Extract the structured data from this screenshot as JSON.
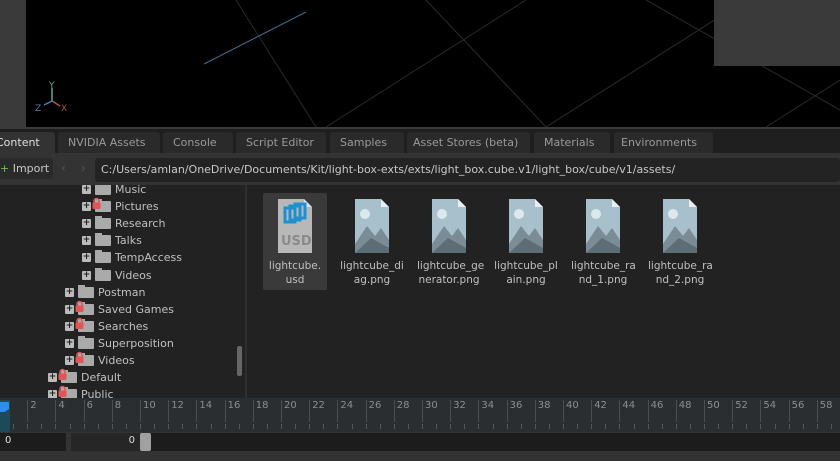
{
  "viewport": {
    "axis_labels": {
      "x": "X",
      "y": "Y",
      "z": "Z"
    }
  },
  "tabs": [
    {
      "label": "Content",
      "active": true
    },
    {
      "label": "NVIDIA Assets"
    },
    {
      "label": "Console"
    },
    {
      "label": "Script Editor"
    },
    {
      "label": "Samples"
    },
    {
      "label": "Asset Stores (beta)"
    },
    {
      "label": "Materials"
    },
    {
      "label": "Environments"
    }
  ],
  "toolbar": {
    "import_label": "Import",
    "import_icon": "+",
    "back_icon": "‹",
    "forward_icon": "›",
    "path": "C:/Users/amlan/OneDrive/Documents/Kit/light-box-exts/exts/light_box.cube.v1/light_box/cube/v1/assets/"
  },
  "tree": [
    {
      "label": "Music",
      "level": 2,
      "locked": false
    },
    {
      "label": "Pictures",
      "level": 2,
      "locked": true
    },
    {
      "label": "Research",
      "level": 2,
      "locked": false
    },
    {
      "label": "Talks",
      "level": 2,
      "locked": false
    },
    {
      "label": "TempAccess",
      "level": 2,
      "locked": false
    },
    {
      "label": "Videos",
      "level": 2,
      "locked": false
    },
    {
      "label": "Postman",
      "level": 1,
      "locked": false
    },
    {
      "label": "Saved Games",
      "level": 1,
      "locked": true
    },
    {
      "label": "Searches",
      "level": 1,
      "locked": true
    },
    {
      "label": "Superposition",
      "level": 1,
      "locked": false
    },
    {
      "label": "Videos",
      "level": 1,
      "locked": true
    },
    {
      "label": "Default",
      "level": 0,
      "locked": true
    },
    {
      "label": "Public",
      "level": 0,
      "locked": true
    }
  ],
  "files": [
    {
      "name": "lightcube.\nusd",
      "type": "usd",
      "selected": true,
      "badge": "USD"
    },
    {
      "name": "lightcube_di\nag.png",
      "type": "image"
    },
    {
      "name": "lightcube_ge\nnerator.png",
      "type": "image"
    },
    {
      "name": "lightcube_pl\nain.png",
      "type": "image"
    },
    {
      "name": "lightcube_ra\nnd_1.png",
      "type": "image"
    },
    {
      "name": "lightcube_ra\nnd_2.png",
      "type": "image"
    }
  ],
  "timeline": {
    "ticks": [
      2,
      4,
      6,
      8,
      10,
      12,
      14,
      16,
      18,
      20,
      22,
      24,
      26,
      28,
      30,
      32,
      34,
      36,
      38,
      40,
      42,
      44,
      46,
      48,
      50,
      52,
      54,
      56,
      58
    ],
    "current_frame": 0,
    "start_value": "0",
    "range_value": "0"
  },
  "colors": {
    "accent": "#2d8cf0",
    "lock": "#e05555"
  }
}
